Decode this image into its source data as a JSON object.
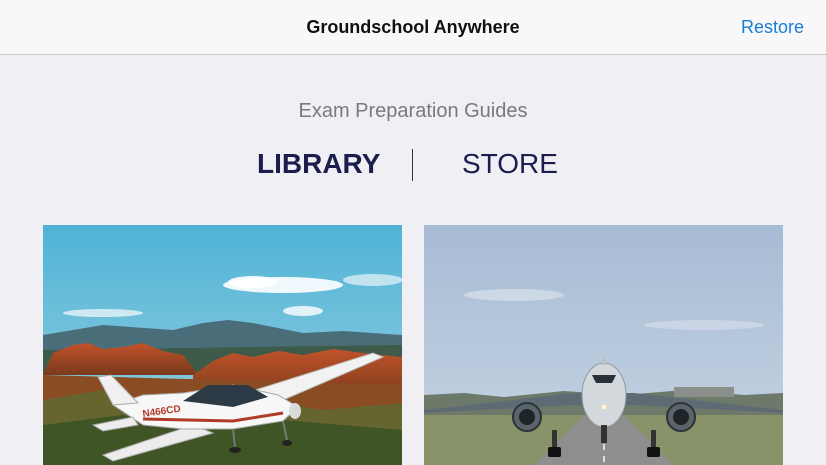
{
  "navbar": {
    "title": "Groundschool Anywhere",
    "restore_label": "Restore"
  },
  "header": {
    "subtitle": "Exam Preparation Guides"
  },
  "segments": {
    "library_label": "LIBRARY",
    "store_label": "STORE",
    "selected": "LIBRARY"
  },
  "cards": [
    {
      "image": "cirrus-plane-over-red-rocks",
      "tail_number": "N466CD"
    },
    {
      "image": "jet-airliner-takeoff"
    }
  ],
  "colors": {
    "accent": "#1a7cd6",
    "segment_text": "#1b1d4d",
    "background": "#efeff4"
  }
}
